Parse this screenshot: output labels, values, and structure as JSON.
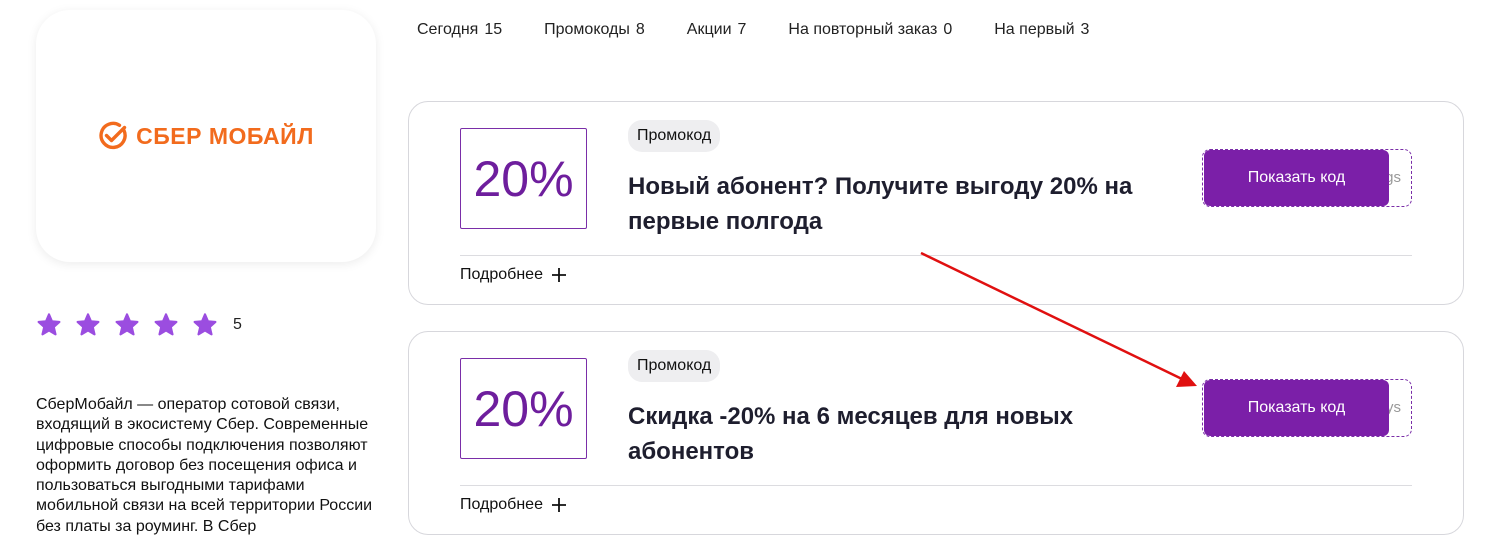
{
  "brand": {
    "name": "СБЕР МОБАЙЛ",
    "color": "#f26b1d",
    "icon": "check-circle-icon"
  },
  "rating": {
    "value": "5",
    "stars_filled": 5,
    "stars_total": 5,
    "star_color": "#9b4de0"
  },
  "description": "СберМобайл — оператор сотовой связи, входящий в экосистему Сбер. Современные цифровые способы подключения позволяют оформить договор без посещения офиса и пользоваться выгодными тарифами мобильной связи на всей территории России без платы за роуминг. В Сбер",
  "tabs": [
    {
      "label": "Сегодня",
      "count": "15"
    },
    {
      "label": "Промокоды",
      "count": "8"
    },
    {
      "label": "Акции",
      "count": "7"
    },
    {
      "label": "На повторный заказ",
      "count": "0"
    },
    {
      "label": "На первый",
      "count": "3"
    }
  ],
  "coupons": [
    {
      "discount": "20%",
      "type": "Промокод",
      "title": "Новый абонент? Получите выгоду 20% на первые полгода",
      "more": "Подробнее",
      "button": "Показать код",
      "code_hint": "gs"
    },
    {
      "discount": "20%",
      "type": "Промокод",
      "title": "Скидка -20% на 6 месяцев для новых абонентов",
      "more": "Подробнее",
      "button": "Показать код",
      "code_hint": "ys"
    }
  ],
  "colors": {
    "accent": "#7b1fa8",
    "annotation_arrow": "#e01010"
  }
}
